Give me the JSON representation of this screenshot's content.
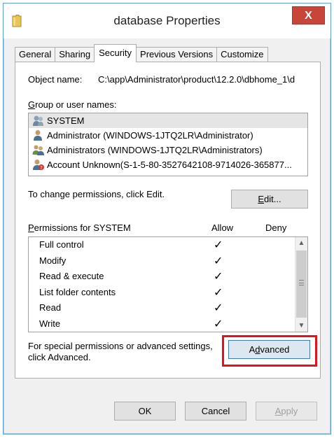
{
  "window": {
    "title": "database Properties",
    "close_label": "X",
    "icon": "folder-icon"
  },
  "tabs": [
    {
      "label": "General",
      "active": false
    },
    {
      "label": "Sharing",
      "active": false
    },
    {
      "label": "Security",
      "active": true
    },
    {
      "label": "Previous Versions",
      "active": false
    },
    {
      "label": "Customize",
      "active": false
    }
  ],
  "security": {
    "object_name_label": "Object name:",
    "object_name_value": "C:\\app\\Administrator\\product\\12.2.0\\dbhome_1\\d",
    "group_label": "Group or user names:",
    "group_label_access_key": "G",
    "users": [
      {
        "name": "SYSTEM",
        "icon": "system-user-icon",
        "selected": true
      },
      {
        "name": "Administrator (WINDOWS-1JTQ2LR\\Administrator)",
        "icon": "user-icon",
        "selected": false
      },
      {
        "name": "Administrators (WINDOWS-1JTQ2LR\\Administrators)",
        "icon": "group-icon",
        "selected": false
      },
      {
        "name": "Account Unknown(S-1-5-80-3527642108-9714026-365877...",
        "icon": "unknown-user-icon",
        "selected": false
      }
    ],
    "edit_hint": "To change permissions, click Edit.",
    "edit_button": "Edit...",
    "permissions_label": "Permissions for SYSTEM",
    "allow_header": "Allow",
    "deny_header": "Deny",
    "permissions": [
      {
        "name": "Full control",
        "allow": "✓",
        "deny": ""
      },
      {
        "name": "Modify",
        "allow": "✓",
        "deny": ""
      },
      {
        "name": "Read & execute",
        "allow": "✓",
        "deny": ""
      },
      {
        "name": "List folder contents",
        "allow": "✓",
        "deny": ""
      },
      {
        "name": "Read",
        "allow": "✓",
        "deny": ""
      },
      {
        "name": "Write",
        "allow": "✓",
        "deny": ""
      }
    ],
    "advanced_hint_line1": "For special permissions or advanced settings,",
    "advanced_hint_line2": "click Advanced.",
    "advanced_button": "Advanced",
    "highlight_color": "#e0141e"
  },
  "buttons": {
    "ok": "OK",
    "cancel": "Cancel",
    "apply": "Apply"
  }
}
